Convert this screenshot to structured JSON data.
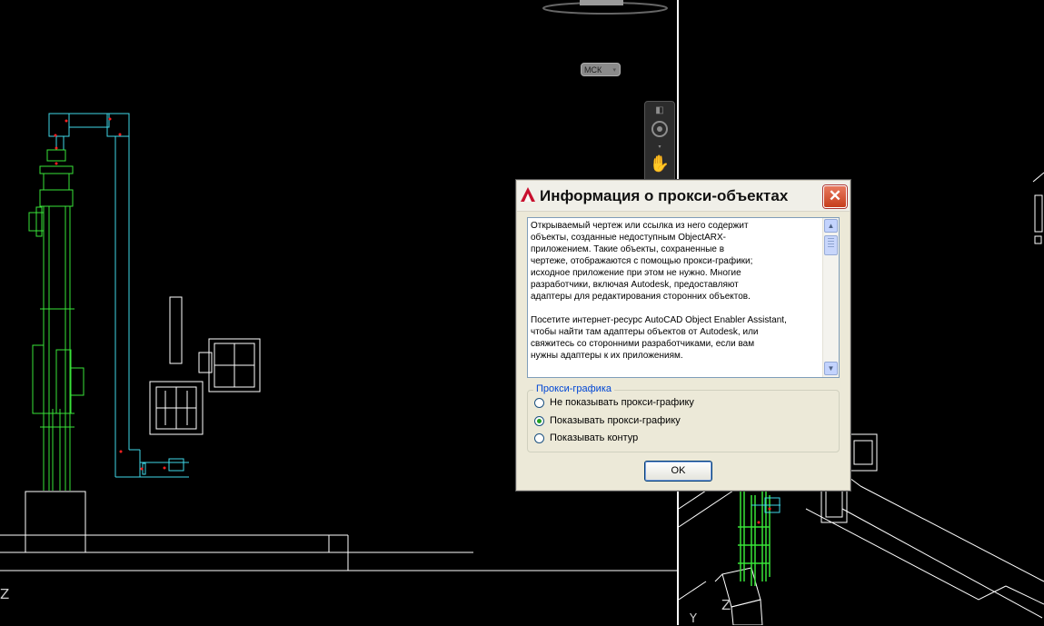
{
  "ucs_button": {
    "label": "МСК"
  },
  "axis_labels": {
    "left_z": "Z",
    "right_z": "Z",
    "right_y": "Y"
  },
  "dialog": {
    "title": "Информация о прокси-объектах",
    "close_glyph": "✕",
    "message": "Открываемый чертеж или ссылка из него содержит\nобъекты, созданные недоступным ObjectARX-\nприложением. Такие объекты, сохраненные в\nчертеже, отображаются с помощью прокси-графики;\nисходное приложение при этом не нужно. Многие\nразработчики, включая Autodesk, предоставляют\nадаптеры для редактирования сторонних объектов.\n\nПосетите интернет-ресурс AutoCAD Object Enabler Assistant,\nчтобы найти там адаптеры объектов от Autodesk, или\nсвяжитесь со сторонними разработчиками, если вам\nнужны адаптеры к их приложениям.",
    "group_label": "Прокси-графика",
    "options": [
      {
        "label": "Не показывать прокси-графику",
        "selected": false
      },
      {
        "label": "Показывать прокси-графику",
        "selected": true
      },
      {
        "label": "Показывать контур",
        "selected": false
      }
    ],
    "ok_label": "OK"
  },
  "icons": {
    "app": "autocad-app-icon",
    "close": "close-icon",
    "scroll_up": "scroll-up-arrow-icon",
    "scroll_down": "scroll-down-arrow-icon",
    "nav_wheel": "steering-wheel-icon",
    "nav_pan": "pan-hand-icon"
  },
  "colors": {
    "drawing_cyan": "#3fd8e8",
    "drawing_green": "#39e339",
    "drawing_white": "#ffffff",
    "accent_red": "#ff2020"
  }
}
